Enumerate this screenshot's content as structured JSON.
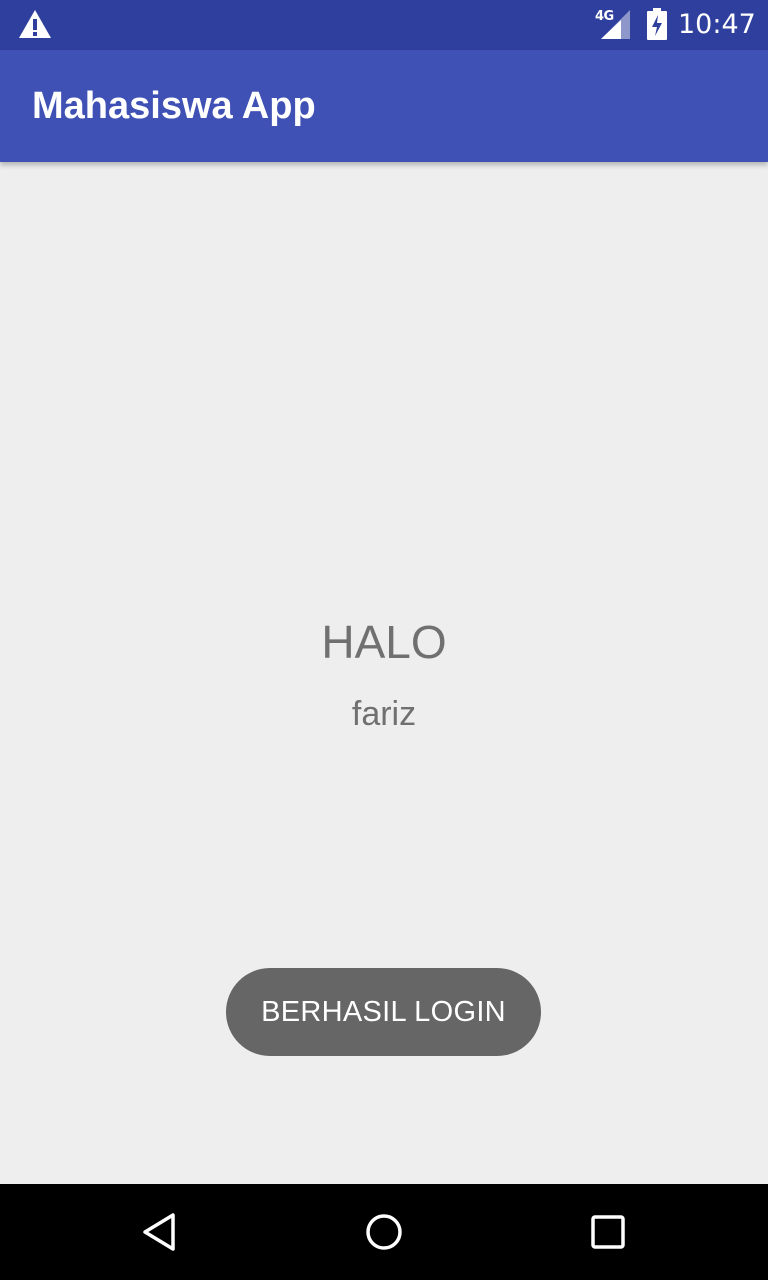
{
  "status_bar": {
    "network_label": "4G",
    "time": "10:47",
    "icons": [
      "warning-icon",
      "signal-icon",
      "battery-charging-icon"
    ]
  },
  "app_bar": {
    "title": "Mahasiswa App"
  },
  "main": {
    "greeting": "HALO",
    "username": "fariz"
  },
  "toast": {
    "message": "BERHASIL LOGIN"
  },
  "nav_bar": {
    "icons": [
      "back-icon",
      "home-icon",
      "recents-icon"
    ]
  },
  "colors": {
    "status_bar": "#2f3f9e",
    "app_bar": "#3f51b5",
    "background": "#eeeeee",
    "toast": "#666666",
    "text_secondary": "#707070"
  }
}
